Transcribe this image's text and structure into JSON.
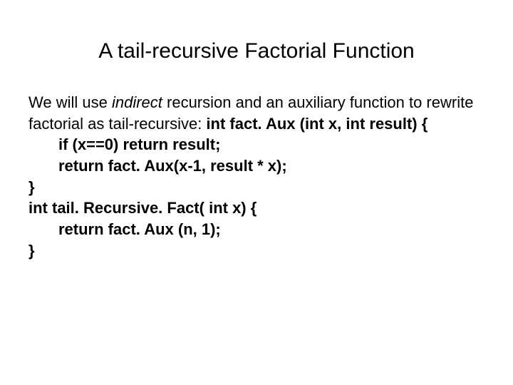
{
  "slide": {
    "title": "A tail-recursive Factorial Function",
    "intro_prefix": "We will use ",
    "intro_italic": "indirect",
    "intro_mid": " recursion and an auxiliary function to rewrite factorial as tail-recursive: ",
    "sig1": "int fact. Aux (int x, int result) {",
    "line_if": "if (x==0) return result;",
    "line_return": "return fact. Aux(x-1, result * x);",
    "close1": "}",
    "sig2": "int tail. Recursive. Fact( int x) {",
    "line_return2": "return fact. Aux (n, 1);",
    "close2": "}"
  }
}
